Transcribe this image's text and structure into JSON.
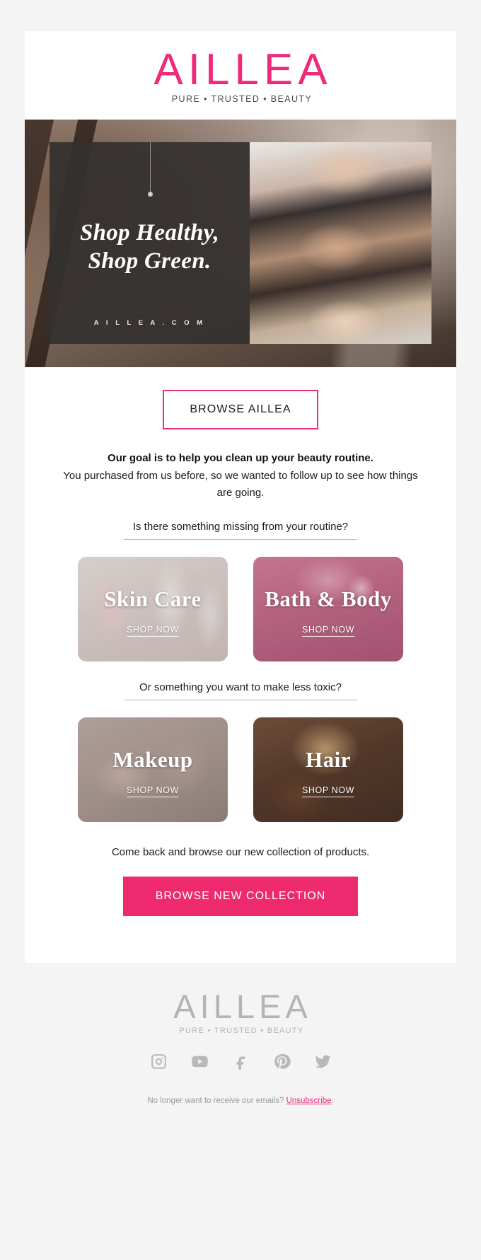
{
  "header": {
    "logo_text": "AILLEA",
    "logo_tagline_parts": [
      "PURE",
      "TRUSTED",
      "BEAUTY"
    ],
    "logo_tagline": "PURE • TRUSTED • BEAUTY",
    "brand_color": "#ee2a7b"
  },
  "hero": {
    "headline_line1": "Shop Healthy,",
    "headline_line2": "Shop Green.",
    "url_text": "A I L L E A . C O M"
  },
  "cta_top": {
    "label": "BROWSE AILLEA"
  },
  "intro": {
    "bold_line": "Our goal is to help you clean up your beauty routine.",
    "body_line": "You purchased from us before, so we wanted to follow up to see how things are going."
  },
  "sections": [
    {
      "question": "Is there something missing from your routine?",
      "tiles": [
        {
          "label": "Skin Care",
          "shop_label": "SHOP NOW",
          "theme": "tile-skincare"
        },
        {
          "label": "Bath & Body",
          "shop_label": "SHOP NOW",
          "theme": "tile-bath"
        }
      ]
    },
    {
      "question": "Or something you want to make less toxic?",
      "tiles": [
        {
          "label": "Makeup",
          "shop_label": "SHOP NOW",
          "theme": "tile-makeup"
        },
        {
          "label": "Hair",
          "shop_label": "SHOP NOW",
          "theme": "tile-hair"
        }
      ]
    }
  ],
  "closing": {
    "text": "Come back and browse our new collection of products.",
    "cta_label": "BROWSE NEW COLLECTION",
    "cta_color": "#ee2a6e"
  },
  "footer": {
    "logo_text": "AILLEA",
    "logo_tagline": "PURE • TRUSTED • BEAUTY",
    "socials": [
      "instagram-icon",
      "youtube-icon",
      "facebook-icon",
      "pinterest-icon",
      "twitter-icon"
    ],
    "unsubscribe_prefix": "No longer want to receive our emails? ",
    "unsubscribe_link": "Unsubscribe",
    "unsubscribe_suffix": "."
  }
}
